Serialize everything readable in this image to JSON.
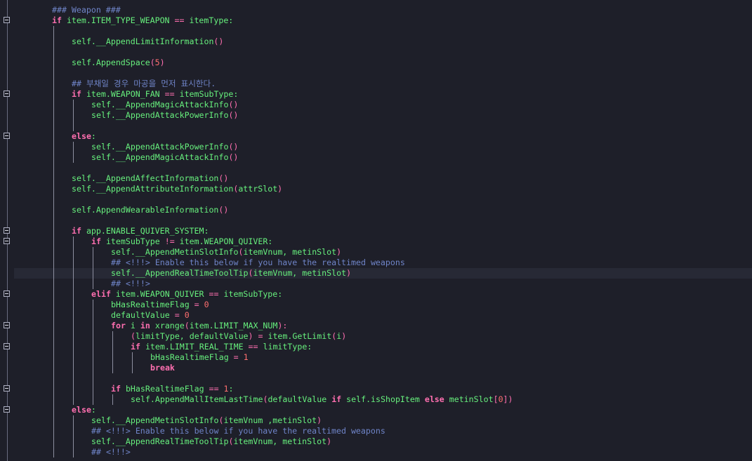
{
  "editor": {
    "colors": {
      "background": "#1e1f29",
      "current_line": "#272935",
      "keyword": "#ff6fb0",
      "identifier": "#67f07d",
      "number": "#ff6f6f",
      "comment": "#6f84c8"
    },
    "current_line_index": 25,
    "lines": [
      {
        "indent": 0,
        "fold": false,
        "tokens": [
          {
            "t": "### Weapon ###",
            "c": "cm"
          }
        ]
      },
      {
        "indent": 0,
        "fold": true,
        "tokens": [
          {
            "t": "if",
            "c": "kw"
          },
          {
            "t": " item.ITEM_TYPE_WEAPON ",
            "c": "id"
          },
          {
            "t": "==",
            "c": "op"
          },
          {
            "t": " itemType:",
            "c": "id"
          }
        ]
      },
      {
        "indent": 1,
        "fold": false,
        "tokens": []
      },
      {
        "indent": 1,
        "fold": false,
        "tokens": [
          {
            "t": "self.__AppendLimitInformation",
            "c": "id"
          },
          {
            "t": "()",
            "c": "p"
          }
        ]
      },
      {
        "indent": 1,
        "fold": false,
        "tokens": []
      },
      {
        "indent": 1,
        "fold": false,
        "tokens": [
          {
            "t": "self.AppendSpace",
            "c": "id"
          },
          {
            "t": "(",
            "c": "p"
          },
          {
            "t": "5",
            "c": "num"
          },
          {
            "t": ")",
            "c": "p"
          }
        ]
      },
      {
        "indent": 1,
        "fold": false,
        "tokens": []
      },
      {
        "indent": 1,
        "fold": false,
        "tokens": [
          {
            "t": "## 부채일 경우 마공을 먼저 표시한다.",
            "c": "cm"
          }
        ]
      },
      {
        "indent": 1,
        "fold": true,
        "tokens": [
          {
            "t": "if",
            "c": "kw"
          },
          {
            "t": " item.WEAPON_FAN ",
            "c": "id"
          },
          {
            "t": "==",
            "c": "op"
          },
          {
            "t": " itemSubType:",
            "c": "id"
          }
        ]
      },
      {
        "indent": 2,
        "fold": false,
        "tokens": [
          {
            "t": "self.__AppendMagicAttackInfo",
            "c": "id"
          },
          {
            "t": "()",
            "c": "p"
          }
        ]
      },
      {
        "indent": 2,
        "fold": false,
        "tokens": [
          {
            "t": "self.__AppendAttackPowerInfo",
            "c": "id"
          },
          {
            "t": "()",
            "c": "p"
          }
        ]
      },
      {
        "indent": 2,
        "fold": false,
        "tokens": []
      },
      {
        "indent": 1,
        "fold": true,
        "tokens": [
          {
            "t": "else",
            "c": "kw"
          },
          {
            "t": ":",
            "c": "id"
          }
        ]
      },
      {
        "indent": 2,
        "fold": false,
        "tokens": [
          {
            "t": "self.__AppendAttackPowerInfo",
            "c": "id"
          },
          {
            "t": "()",
            "c": "p"
          }
        ]
      },
      {
        "indent": 2,
        "fold": false,
        "tokens": [
          {
            "t": "self.__AppendMagicAttackInfo",
            "c": "id"
          },
          {
            "t": "()",
            "c": "p"
          }
        ]
      },
      {
        "indent": 1,
        "fold": false,
        "tokens": []
      },
      {
        "indent": 1,
        "fold": false,
        "tokens": [
          {
            "t": "self.__AppendAffectInformation",
            "c": "id"
          },
          {
            "t": "()",
            "c": "p"
          }
        ]
      },
      {
        "indent": 1,
        "fold": false,
        "tokens": [
          {
            "t": "self.__AppendAttributeInformation",
            "c": "id"
          },
          {
            "t": "(",
            "c": "p"
          },
          {
            "t": "attrSlot",
            "c": "id"
          },
          {
            "t": ")",
            "c": "p"
          }
        ]
      },
      {
        "indent": 1,
        "fold": false,
        "tokens": []
      },
      {
        "indent": 1,
        "fold": false,
        "tokens": [
          {
            "t": "self.AppendWearableInformation",
            "c": "id"
          },
          {
            "t": "()",
            "c": "p"
          }
        ]
      },
      {
        "indent": 1,
        "fold": false,
        "tokens": []
      },
      {
        "indent": 1,
        "fold": true,
        "tokens": [
          {
            "t": "if",
            "c": "kw"
          },
          {
            "t": " app.ENABLE_QUIVER_SYSTEM:",
            "c": "id"
          }
        ]
      },
      {
        "indent": 2,
        "fold": true,
        "tokens": [
          {
            "t": "if",
            "c": "kw"
          },
          {
            "t": " itemSubType ",
            "c": "id"
          },
          {
            "t": "!=",
            "c": "op"
          },
          {
            "t": " item.WEAPON_QUIVER:",
            "c": "id"
          }
        ]
      },
      {
        "indent": 3,
        "fold": false,
        "tokens": [
          {
            "t": "self.__AppendMetinSlotInfo",
            "c": "id"
          },
          {
            "t": "(",
            "c": "p"
          },
          {
            "t": "itemVnum, metinSlot",
            "c": "id"
          },
          {
            "t": ")",
            "c": "p"
          }
        ]
      },
      {
        "indent": 3,
        "fold": false,
        "tokens": [
          {
            "t": "## <!!!> Enable this below if you have the realtimed weapons",
            "c": "cm"
          }
        ]
      },
      {
        "indent": 3,
        "fold": false,
        "tokens": [
          {
            "t": "self.__AppendRealTimeToolTip",
            "c": "id"
          },
          {
            "t": "(",
            "c": "p"
          },
          {
            "t": "itemVnum, metinSlot",
            "c": "id"
          },
          {
            "t": ")",
            "c": "p"
          }
        ]
      },
      {
        "indent": 3,
        "fold": false,
        "tokens": [
          {
            "t": "## <!!!>",
            "c": "cm"
          }
        ]
      },
      {
        "indent": 2,
        "fold": true,
        "tokens": [
          {
            "t": "elif",
            "c": "kw"
          },
          {
            "t": " item.WEAPON_QUIVER ",
            "c": "id"
          },
          {
            "t": "==",
            "c": "op"
          },
          {
            "t": " itemSubType:",
            "c": "id"
          }
        ]
      },
      {
        "indent": 3,
        "fold": false,
        "tokens": [
          {
            "t": "bHasRealtimeFlag ",
            "c": "id"
          },
          {
            "t": "=",
            "c": "op"
          },
          {
            "t": " 0",
            "c": "num"
          }
        ]
      },
      {
        "indent": 3,
        "fold": false,
        "tokens": [
          {
            "t": "defaultValue ",
            "c": "id"
          },
          {
            "t": "=",
            "c": "op"
          },
          {
            "t": " 0",
            "c": "num"
          }
        ]
      },
      {
        "indent": 3,
        "fold": true,
        "tokens": [
          {
            "t": "for",
            "c": "kw"
          },
          {
            "t": " i ",
            "c": "id"
          },
          {
            "t": "in",
            "c": "kw"
          },
          {
            "t": " xrange",
            "c": "id"
          },
          {
            "t": "(",
            "c": "p"
          },
          {
            "t": "item.LIMIT_MAX_NUM",
            "c": "id"
          },
          {
            "t": "):",
            "c": "p"
          }
        ]
      },
      {
        "indent": 4,
        "fold": false,
        "tokens": [
          {
            "t": "(",
            "c": "p"
          },
          {
            "t": "limitType, defaultValue",
            "c": "id"
          },
          {
            "t": ")",
            "c": "p"
          },
          {
            "t": " = ",
            "c": "op"
          },
          {
            "t": "item.GetLimit",
            "c": "id"
          },
          {
            "t": "(",
            "c": "p"
          },
          {
            "t": "i",
            "c": "id"
          },
          {
            "t": ")",
            "c": "p"
          }
        ]
      },
      {
        "indent": 4,
        "fold": true,
        "tokens": [
          {
            "t": "if",
            "c": "kw"
          },
          {
            "t": " item.LIMIT_REAL_TIME ",
            "c": "id"
          },
          {
            "t": "==",
            "c": "op"
          },
          {
            "t": " limitType:",
            "c": "id"
          }
        ]
      },
      {
        "indent": 5,
        "fold": false,
        "tokens": [
          {
            "t": "bHasRealtimeFlag ",
            "c": "id"
          },
          {
            "t": "=",
            "c": "op"
          },
          {
            "t": " 1",
            "c": "num"
          }
        ]
      },
      {
        "indent": 5,
        "fold": false,
        "tokens": [
          {
            "t": "break",
            "c": "kw"
          }
        ]
      },
      {
        "indent": 3,
        "fold": false,
        "tokens": []
      },
      {
        "indent": 3,
        "fold": true,
        "tokens": [
          {
            "t": "if",
            "c": "kw"
          },
          {
            "t": " bHasRealtimeFlag ",
            "c": "id"
          },
          {
            "t": "==",
            "c": "op"
          },
          {
            "t": " 1",
            "c": "num"
          },
          {
            "t": ":",
            "c": "id"
          }
        ]
      },
      {
        "indent": 4,
        "fold": false,
        "tokens": [
          {
            "t": "self.AppendMallItemLastTime",
            "c": "id"
          },
          {
            "t": "(",
            "c": "p"
          },
          {
            "t": "defaultValue ",
            "c": "id"
          },
          {
            "t": "if",
            "c": "kw"
          },
          {
            "t": " self.isShopItem ",
            "c": "id"
          },
          {
            "t": "else",
            "c": "kw"
          },
          {
            "t": " metinSlot",
            "c": "id"
          },
          {
            "t": "[",
            "c": "p"
          },
          {
            "t": "0",
            "c": "num"
          },
          {
            "t": "])",
            "c": "p"
          }
        ]
      },
      {
        "indent": 1,
        "fold": true,
        "tokens": [
          {
            "t": "else",
            "c": "kw"
          },
          {
            "t": ":",
            "c": "id"
          }
        ]
      },
      {
        "indent": 2,
        "fold": false,
        "tokens": [
          {
            "t": "self.__AppendMetinSlotInfo",
            "c": "id"
          },
          {
            "t": "(",
            "c": "p"
          },
          {
            "t": "itemVnum ,metinSlot",
            "c": "id"
          },
          {
            "t": ")",
            "c": "p"
          }
        ]
      },
      {
        "indent": 2,
        "fold": false,
        "tokens": [
          {
            "t": "## <!!!> Enable this below if you have the realtimed weapons",
            "c": "cm"
          }
        ]
      },
      {
        "indent": 2,
        "fold": false,
        "tokens": [
          {
            "t": "self.__AppendRealTimeToolTip",
            "c": "id"
          },
          {
            "t": "(",
            "c": "p"
          },
          {
            "t": "itemVnum, metinSlot",
            "c": "id"
          },
          {
            "t": ")",
            "c": "p"
          }
        ]
      },
      {
        "indent": 2,
        "fold": false,
        "tokens": [
          {
            "t": "## <!!!>",
            "c": "cm"
          }
        ]
      }
    ]
  }
}
